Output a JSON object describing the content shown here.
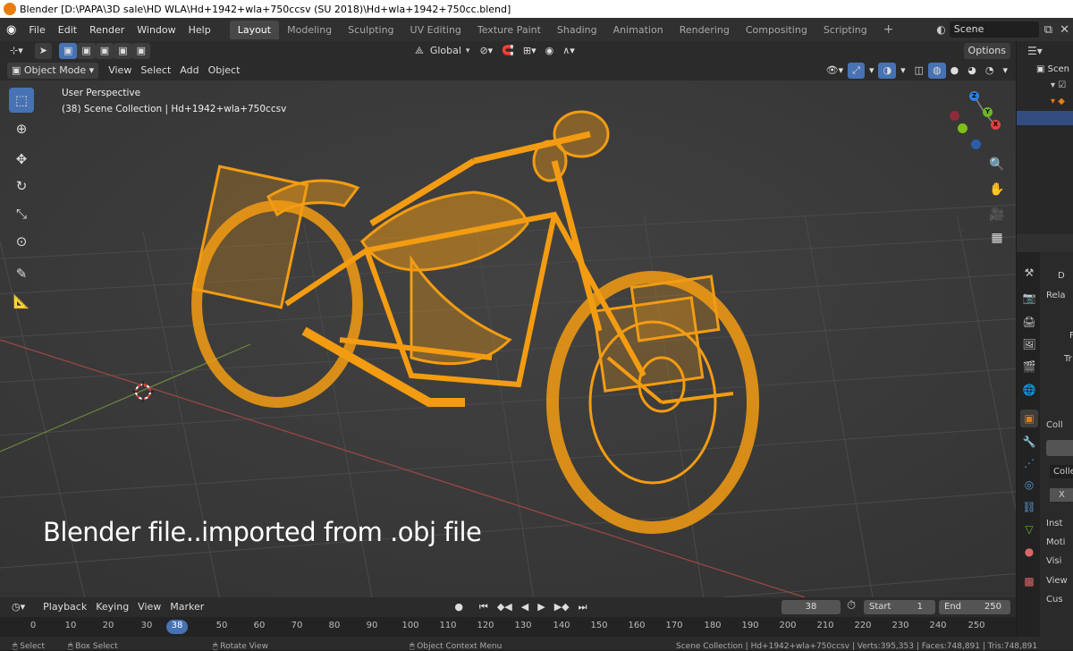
{
  "window": {
    "title": "Blender [D:\\PAPA\\3D sale\\HD WLA\\Hd+1942+wla+750ccsv (SU 2018)\\Hd+wla+1942+750cc.blend]"
  },
  "menu": {
    "items": [
      "File",
      "Edit",
      "Render",
      "Window",
      "Help"
    ]
  },
  "workspaces": [
    "Layout",
    "Modeling",
    "Sculpting",
    "UV Editing",
    "Texture Paint",
    "Shading",
    "Animation",
    "Rendering",
    "Compositing",
    "Scripting"
  ],
  "scene": {
    "name": "Scene"
  },
  "viewport_header": {
    "transform_orientation": "Global",
    "options_label": "Options",
    "mode": "Object Mode",
    "menu": [
      "View",
      "Select",
      "Add",
      "Object"
    ]
  },
  "viewport": {
    "perspective": "User Perspective",
    "collection_info": "(38) Scene Collection | Hd+1942+wla+750ccsv",
    "caption": "Blender file..imported from .obj file",
    "wire_color": "#f39c12"
  },
  "gizmo": {
    "x": "X",
    "y": "Y",
    "z": "Z"
  },
  "outliner": {
    "item1": "Scen"
  },
  "properties": {
    "labels": [
      "D",
      "Rela",
      "F",
      "Tr",
      "Coll",
      "Colle",
      "X",
      "Inst",
      "Moti",
      "Visi",
      "View",
      "Cus"
    ]
  },
  "timeline": {
    "menu": [
      "Playback",
      "Keying",
      "View",
      "Marker"
    ],
    "current_frame": "38",
    "start_label": "Start",
    "start": "1",
    "end_label": "End",
    "end": "250",
    "ticks": [
      "0",
      "10",
      "20",
      "30",
      "38",
      "50",
      "60",
      "70",
      "80",
      "90",
      "100",
      "110",
      "120",
      "130",
      "140",
      "150",
      "160",
      "170",
      "180",
      "190",
      "200",
      "210",
      "220",
      "230",
      "240",
      "250"
    ]
  },
  "statusbar": {
    "select": "Select",
    "box_select": "Box Select",
    "rotate": "Rotate View",
    "context": "Object Context Menu",
    "stats": "Scene Collection | Hd+1942+wla+750ccsv | Verts:395,353 | Faces:748,891 | Tris:748,891"
  }
}
